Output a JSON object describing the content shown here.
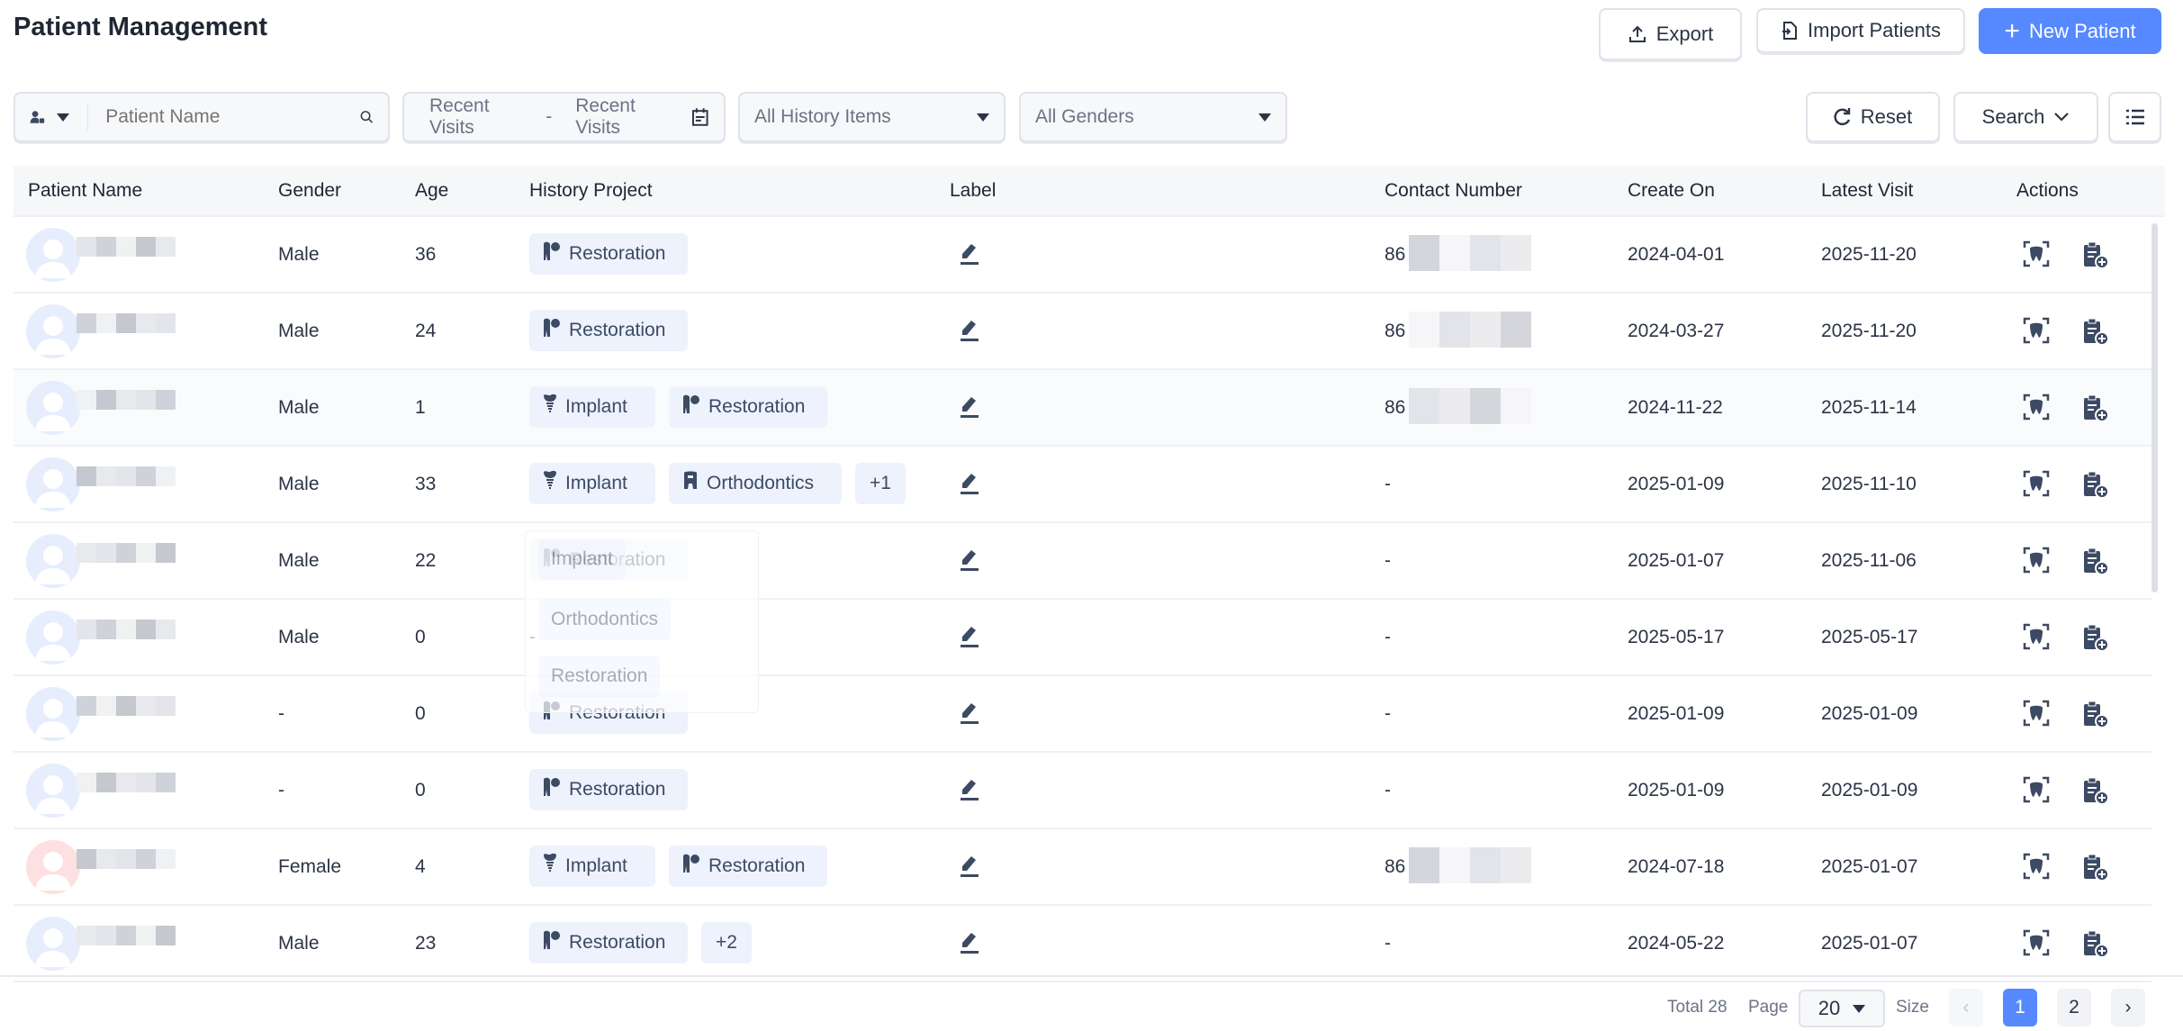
{
  "header": {
    "title": "Patient Management",
    "export_label": "Export",
    "import_label": "Import Patients",
    "new_label": "New Patient"
  },
  "filters": {
    "name_placeholder": "Patient Name",
    "date_start": "Recent Visits",
    "date_sep": "-",
    "date_end": "Recent Visits",
    "history": "All History Items",
    "gender": "All Genders",
    "reset_label": "Reset",
    "search_label": "Search"
  },
  "columns": [
    "Patient Name",
    "Gender",
    "Age",
    "History Project",
    "Label",
    "Contact Number",
    "Create On",
    "Latest Visit",
    "Actions"
  ],
  "rows": [
    {
      "gender": "Male",
      "age": "36",
      "tags": [
        "Restoration"
      ],
      "contact": "86",
      "created": "2024-04-01",
      "latest": "2025-11-20",
      "female": false
    },
    {
      "gender": "Male",
      "age": "24",
      "tags": [
        "Restoration"
      ],
      "contact": "86",
      "created": "2024-03-27",
      "latest": "2025-11-20",
      "female": false
    },
    {
      "gender": "Male",
      "age": "1",
      "tags": [
        "Implant",
        "Restoration"
      ],
      "contact": "86",
      "created": "2024-11-22",
      "latest": "2025-11-14",
      "female": false
    },
    {
      "gender": "Male",
      "age": "33",
      "tags": [
        "Implant",
        "Orthodontics",
        "+1"
      ],
      "contact": "-",
      "created": "2025-01-09",
      "latest": "2025-11-10",
      "female": false
    },
    {
      "gender": "Male",
      "age": "22",
      "tags": [
        "Restoration"
      ],
      "contact": "-",
      "created": "2025-01-07",
      "latest": "2025-11-06",
      "female": false
    },
    {
      "gender": "Male",
      "age": "0",
      "tags": [],
      "contact": "-",
      "created": "2025-05-17",
      "latest": "2025-05-17",
      "female": false
    },
    {
      "gender": "-",
      "age": "0",
      "tags": [
        "Restoration"
      ],
      "contact": "-",
      "created": "2025-01-09",
      "latest": "2025-01-09",
      "female": false
    },
    {
      "gender": "-",
      "age": "0",
      "tags": [
        "Restoration"
      ],
      "contact": "-",
      "created": "2025-01-09",
      "latest": "2025-01-09",
      "female": false
    },
    {
      "gender": "Female",
      "age": "4",
      "tags": [
        "Implant",
        "Restoration"
      ],
      "contact": "86",
      "created": "2024-07-18",
      "latest": "2025-01-07",
      "female": true
    },
    {
      "gender": "Male",
      "age": "23",
      "tags": [
        "Restoration",
        "+2"
      ],
      "contact": "-",
      "created": "2024-05-22",
      "latest": "2025-01-07",
      "female": false
    }
  ],
  "popover": {
    "items": [
      "Implant",
      "Orthodontics",
      "Restoration"
    ]
  },
  "pagination": {
    "total": "Total 28",
    "page_label": "Page",
    "size": "20",
    "size_label": "Size",
    "pages": [
      "1",
      "2"
    ],
    "current": "1"
  },
  "colors": {
    "primary": "#5689ff",
    "tag_bg": "#edf2fd",
    "icon": "#3c4a63"
  },
  "empty": "-"
}
